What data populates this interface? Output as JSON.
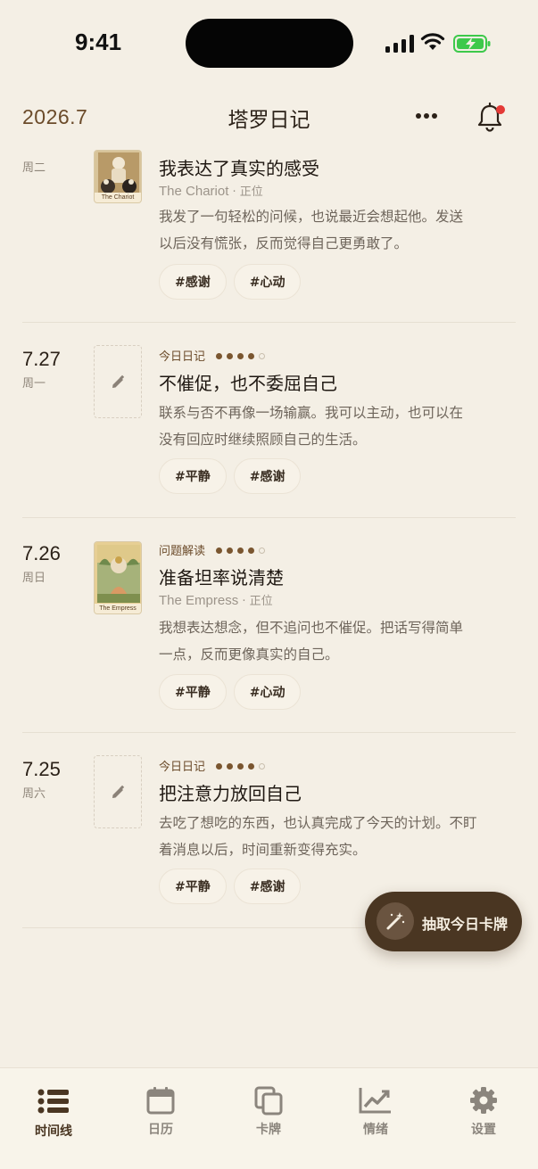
{
  "status_bar": {
    "time": "9:41"
  },
  "header": {
    "date": "2026.7",
    "title": "塔罗日记"
  },
  "entries": [
    {
      "date": "",
      "weekday": "周二",
      "card_label": "The Chariot",
      "title": "我表达了真实的感受",
      "card_name": "The Chariot",
      "orientation": " · 正位",
      "body_line1": "我发了一句轻松的问候，也说最近会想起他。发送",
      "body_line2": "以后没有慌张，反而觉得自己更勇敢了。",
      "tags": [
        "#感谢",
        "#心动"
      ]
    },
    {
      "date": "7.27",
      "weekday": "周一",
      "type": "今日日记",
      "rating": 4,
      "title": "不催促，也不委屈自己",
      "body_line1": "联系与否不再像一场输赢。我可以主动，也可以在",
      "body_line2": "没有回应时继续照顾自己的生活。",
      "tags": [
        "#平静",
        "#感谢"
      ]
    },
    {
      "date": "7.26",
      "weekday": "周日",
      "type": "问题解读",
      "rating": 4,
      "card_label": "The Empress",
      "title": "准备坦率说清楚",
      "card_name": "The Empress",
      "orientation": " · 正位",
      "body_line1": "我想表达想念，但不追问也不催促。把话写得简单",
      "body_line2": "一点，反而更像真实的自己。",
      "tags": [
        "#平静",
        "#心动"
      ]
    },
    {
      "date": "7.25",
      "weekday": "周六",
      "type": "今日日记",
      "rating": 4,
      "title": "把注意力放回自己",
      "body_line1": "去吃了想吃的东西，也认真完成了今天的计划。不盯",
      "body_line2": "着消息以后，时间重新变得充实。",
      "tags": [
        "#平静",
        "#感谢"
      ]
    }
  ],
  "fab": {
    "label": "抽取今日卡牌",
    "icon": "magic-wand-icon"
  },
  "tabs": [
    {
      "label": "时间线",
      "icon": "list-icon",
      "active": true
    },
    {
      "label": "日历",
      "icon": "calendar-icon",
      "active": false
    },
    {
      "label": "卡牌",
      "icon": "cards-icon",
      "active": false
    },
    {
      "label": "情绪",
      "icon": "trend-chart-icon",
      "active": false
    },
    {
      "label": "设置",
      "icon": "gear-icon",
      "active": false
    }
  ],
  "colors": {
    "background": "#f4efe5",
    "accent": "#4a3622",
    "rating_dot": "#7a5630",
    "notification_dot": "#e43a36",
    "battery": "#3dc94b"
  }
}
